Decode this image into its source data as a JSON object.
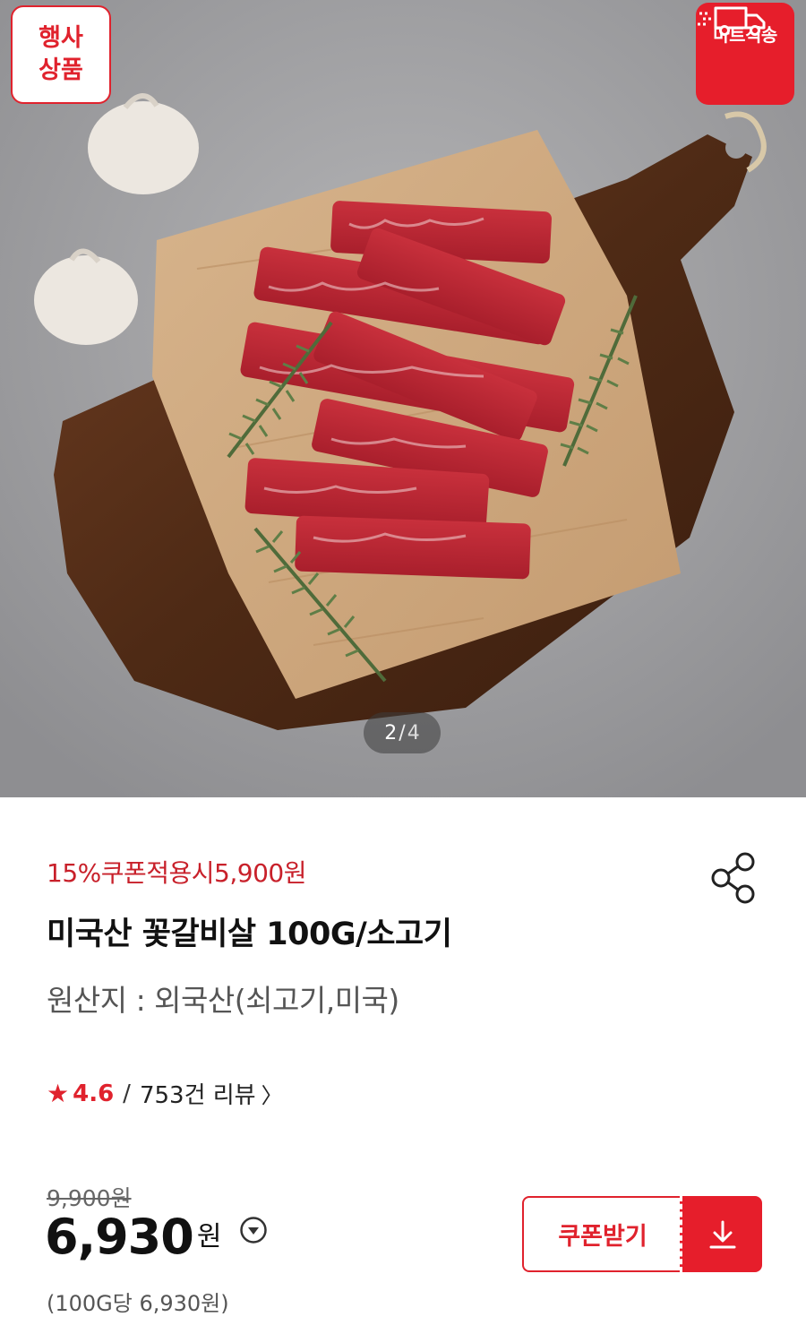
{
  "badges": {
    "event_line1": "행사",
    "event_line2": "상품",
    "mart_label": "마트직송",
    "mart_icon": "delivery-truck-icon"
  },
  "gallery": {
    "current": "2",
    "separator": "/",
    "total": "4"
  },
  "product": {
    "coupon_text": "15%쿠폰적용시5,900원",
    "title": "미국산 꽃갈비살 100G/소고기",
    "origin": "원산지 : 외국산(쇠고기,미국)",
    "share_icon": "share-icon"
  },
  "rating": {
    "star_icon": "★",
    "score": "4.6",
    "slash": "/",
    "reviews": "753건 리뷰",
    "chevron": "〉"
  },
  "pricing": {
    "original": "9,900원",
    "price": "6,930",
    "won": "원",
    "unit_price": "(100G당 6,930원)",
    "info_icon": "chevron-down-circle-icon"
  },
  "coupon_button": {
    "label": "쿠폰받기",
    "icon": "download-icon"
  },
  "colors": {
    "accent": "#e0222d",
    "accent_fill": "#e61e2b"
  }
}
